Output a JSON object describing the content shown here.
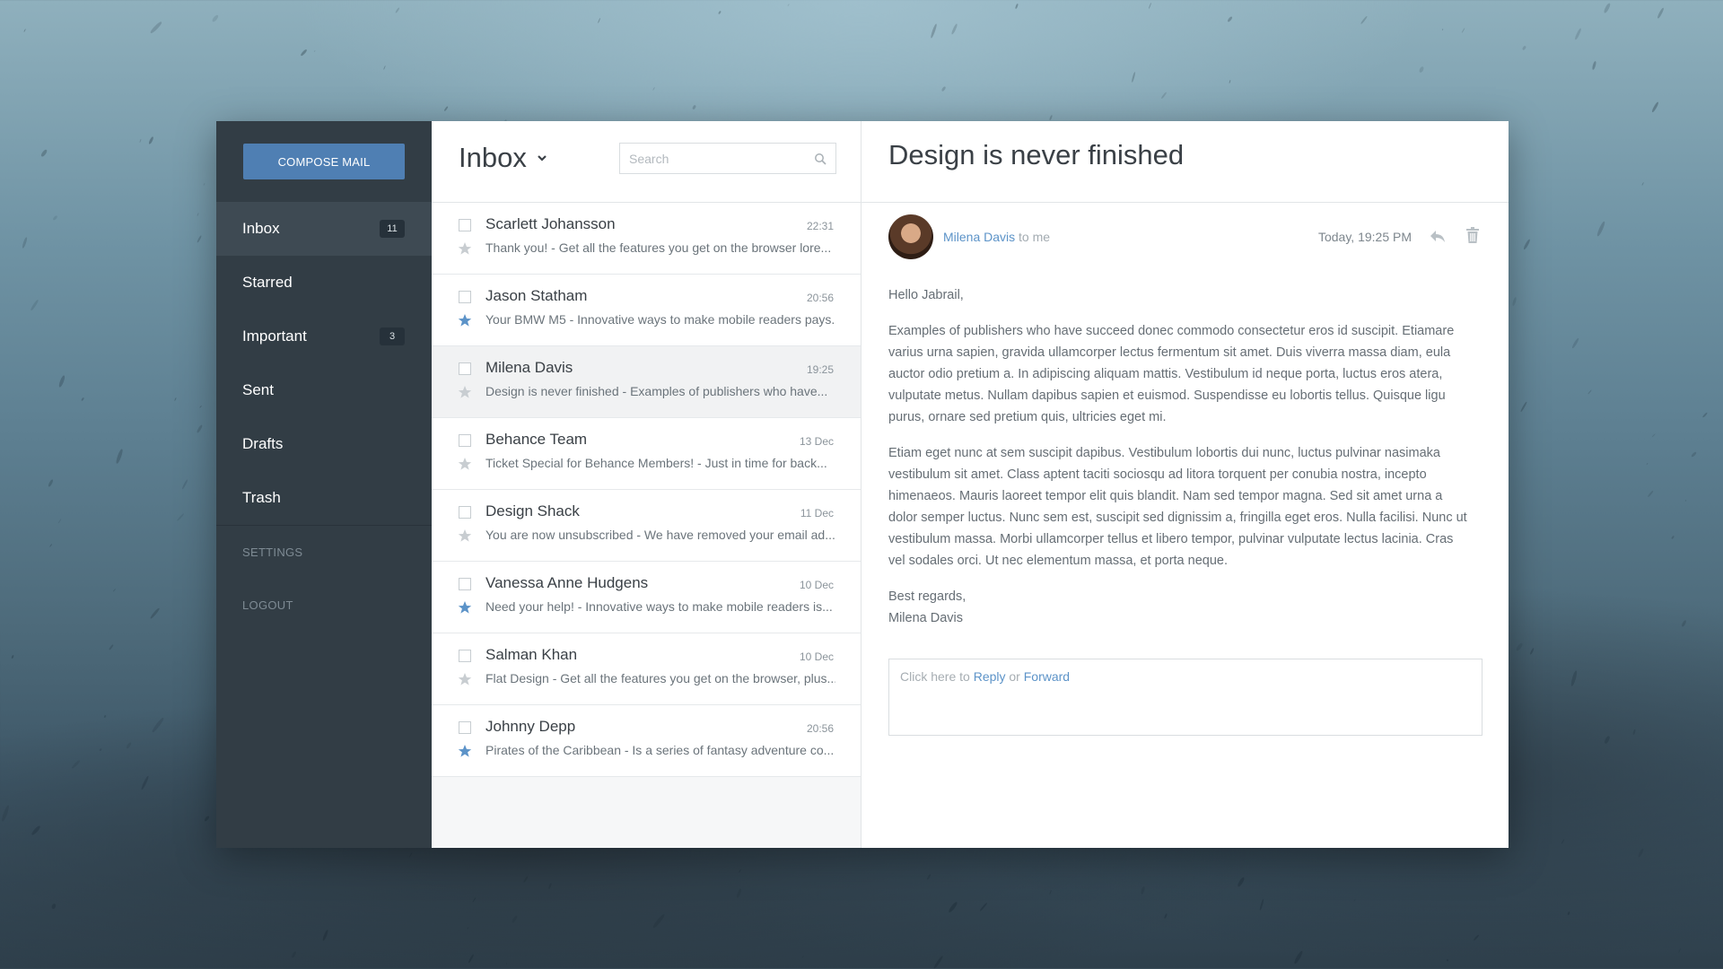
{
  "sidebar": {
    "compose_label": "COMPOSE MAIL",
    "items": [
      {
        "label": "Inbox",
        "badge": "11",
        "active": true
      },
      {
        "label": "Starred",
        "badge": ""
      },
      {
        "label": "Important",
        "badge": "3"
      },
      {
        "label": "Sent",
        "badge": ""
      },
      {
        "label": "Drafts",
        "badge": ""
      },
      {
        "label": "Trash",
        "badge": ""
      }
    ],
    "settings_label": "SETTINGS",
    "logout_label": "LOGOUT"
  },
  "list": {
    "folder_title": "Inbox",
    "search_placeholder": "Search",
    "messages": [
      {
        "sender": "Scarlett Johansson",
        "time": "22:31",
        "snippet": "Thank you! - Get all the features you get on the browser lore...",
        "starred": false
      },
      {
        "sender": "Jason Statham",
        "time": "20:56",
        "snippet": "Your BMW M5 - Innovative ways to make mobile readers pays...",
        "starred": true
      },
      {
        "sender": "Milena Davis",
        "time": "19:25",
        "snippet": "Design is never finished - Examples of publishers who have...",
        "starred": false,
        "selected": true
      },
      {
        "sender": "Behance Team",
        "time": "13 Dec",
        "snippet": "Ticket Special for Behance Members! - Just in time for back...",
        "starred": false
      },
      {
        "sender": "Design Shack",
        "time": "11 Dec",
        "snippet": "You are now unsubscribed - We have removed your email ad...",
        "starred": false
      },
      {
        "sender": "Vanessa Anne Hudgens",
        "time": "10 Dec",
        "snippet": "Need your help! - Innovative ways to make mobile readers is...",
        "starred": true
      },
      {
        "sender": "Salman Khan",
        "time": "10 Dec",
        "snippet": "Flat Design - Get all the features you get on the browser, plus...",
        "starred": false
      },
      {
        "sender": "Johnny Depp",
        "time": "20:56",
        "snippet": "Pirates of the Caribbean - Is a series of fantasy adventure co...",
        "starred": true
      }
    ]
  },
  "reader": {
    "subject": "Design is never finished",
    "from_name": "Milena Davis",
    "to_label": "to me",
    "date": "Today, 19:25 PM",
    "greeting": "Hello Jabrail,",
    "paragraph1": "Examples of publishers who have succeed donec commodo consectetur eros id suscipit. Etiamare varius urna sapien, gravida ullamcorper lectus fermentum sit amet. Duis viverra massa diam, eula auctor odio pretium a. In adipiscing aliquam mattis. Vestibulum id neque porta, luctus eros atera, vulputate metus. Nullam dapibus sapien et euismod. Suspendisse eu lobortis tellus. Quisque ligu purus, ornare sed pretium quis, ultricies eget mi.",
    "paragraph2": "Etiam eget nunc at sem suscipit dapibus. Vestibulum lobortis dui nunc, luctus pulvinar nasimaka vestibulum sit amet. Class aptent taciti sociosqu ad litora torquent per conubia nostra, incepto himenaeos.  Mauris laoreet tempor elit quis blandit. Nam sed tempor magna. Sed sit amet urna a dolor semper luctus. Nunc sem est, suscipit sed dignissim a, fringilla eget eros. Nulla facilisi. Nunc ut vestibulum massa. Morbi ullamcorper tellus et libero tempor, pulvinar vulputate lectus lacinia. Cras vel sodales orci. Ut nec elementum massa, et porta neque.",
    "signoff": "Best regards,",
    "signature": "Milena Davis",
    "reply_prefix": "Click here to",
    "reply_link": "Reply",
    "reply_or": "or",
    "forward_link": "Forward"
  },
  "colors": {
    "accent": "#4f7fb3",
    "link": "#5c93c8",
    "sidebar_bg": "#323d45",
    "star_active": "#5c93c8",
    "star_inactive": "#c8cdd1"
  },
  "icons": {
    "search": "search-icon",
    "star": "star-icon",
    "reply": "reply-icon",
    "trash": "trash-icon",
    "chevron": "chevron-down-icon"
  }
}
